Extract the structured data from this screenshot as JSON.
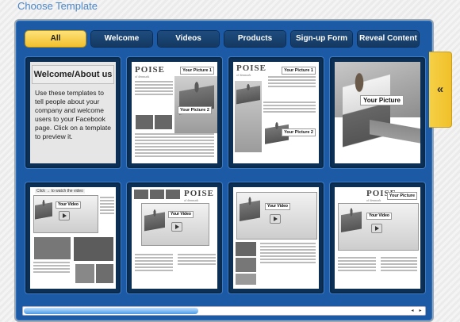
{
  "header": {
    "title": "Choose Template"
  },
  "tabs": [
    {
      "label": "All",
      "active": true
    },
    {
      "label": "Welcome",
      "active": false
    },
    {
      "label": "Videos",
      "active": false
    },
    {
      "label": "Products",
      "active": false
    },
    {
      "label": "Sign-up Form",
      "active": false
    },
    {
      "label": "Reveal Content",
      "active": false
    }
  ],
  "welcome_card": {
    "title": "Welcome/About us",
    "body": "Use these templates to tell people about your company and welcome users to your Facebook page. Click on a template to preview it."
  },
  "templates": {
    "logo": "POISE",
    "logo_sub": "of denmark",
    "your_picture": "Your Picture",
    "your_picture_1": "Your Picture 1",
    "your_picture_2": "Your Picture 2",
    "your_video": "Your Video",
    "click_to_watch": "Click → to watch the video"
  },
  "side_tab": {
    "icon": "double-chevron-left-icon",
    "glyph": "«"
  },
  "scrollbar": {
    "left_arrow": "◂",
    "right_arrow": "▸",
    "position_fraction": 0.0
  },
  "colors": {
    "accent": "#f2c02c",
    "panel": "#1d5aa5",
    "title": "#4a86c8"
  }
}
